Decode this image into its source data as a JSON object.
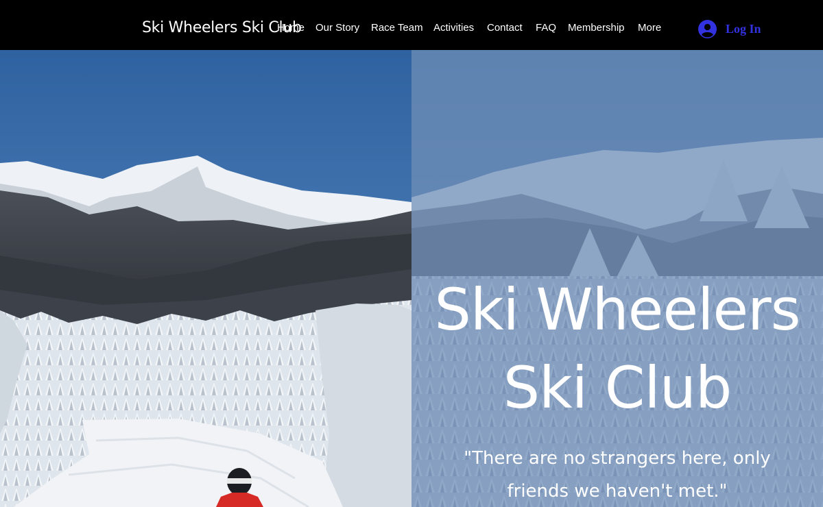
{
  "header": {
    "site_title": "Ski Wheelers Ski Club",
    "nav": [
      {
        "label": "Home"
      },
      {
        "label": "Our Story"
      },
      {
        "label": "Race Team"
      },
      {
        "label": "Activities"
      },
      {
        "label": "Contact"
      },
      {
        "label": "FAQ"
      },
      {
        "label": "Membership"
      },
      {
        "label": "More"
      }
    ],
    "login": {
      "label": "Log In",
      "icon": "user-avatar-icon"
    }
  },
  "hero": {
    "title_line1": "Ski Wheelers",
    "title_line2": "Ski Club",
    "quote_line1": "\"There are no strangers here, only",
    "quote_line2": "friends we haven't met.\""
  },
  "colors": {
    "header_bg": "#000000",
    "login_accent": "#3232e0",
    "overlay_tint": "#6e8cb6",
    "sky": "#3b6fa8"
  }
}
